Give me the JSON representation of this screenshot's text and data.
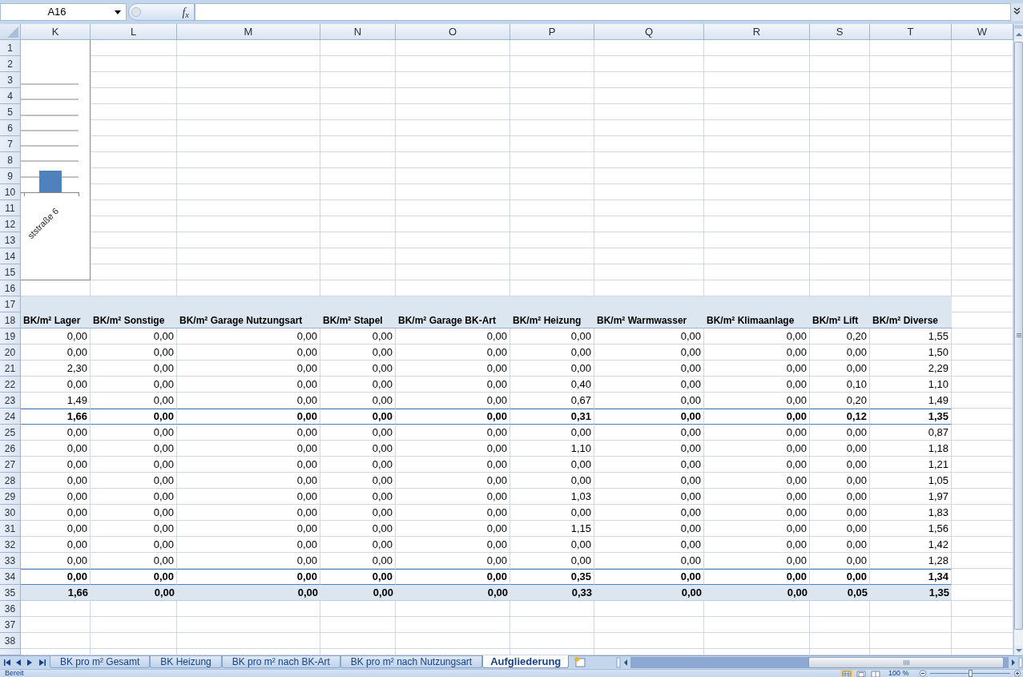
{
  "formula_bar": {
    "name_box": "A16",
    "function_button": "f$_{x}$"
  },
  "chart": {
    "category_label": "ststraße 6"
  },
  "sheet": {
    "columns": [
      "K",
      "L",
      "M",
      "N",
      "O",
      "P",
      "Q",
      "R",
      "S",
      "T",
      "W"
    ],
    "rows": [
      {
        "number": "1",
        "kind": "blank"
      },
      {
        "number": "2",
        "kind": "blank"
      },
      {
        "number": "3",
        "kind": "blank"
      },
      {
        "number": "4",
        "kind": "blank"
      },
      {
        "number": "5",
        "kind": "blank"
      },
      {
        "number": "6",
        "kind": "blank"
      },
      {
        "number": "7",
        "kind": "blank"
      },
      {
        "number": "8",
        "kind": "blank"
      },
      {
        "number": "9",
        "kind": "blank"
      },
      {
        "number": "10",
        "kind": "blank"
      },
      {
        "number": "11",
        "kind": "blank"
      },
      {
        "number": "12",
        "kind": "blank"
      },
      {
        "number": "13",
        "kind": "blank"
      },
      {
        "number": "14",
        "kind": "blank"
      },
      {
        "number": "15",
        "kind": "blank"
      },
      {
        "number": "16",
        "kind": "blank"
      },
      {
        "number": "17",
        "kind": "band"
      },
      {
        "number": "18",
        "kind": "header",
        "cells": [
          "BK/m² Lager",
          "BK/m² Sonstige",
          "BK/m² Garage Nutzungsart",
          "BK/m² Stapel",
          "BK/m² Garage BK-Art",
          "BK/m² Heizung",
          "BK/m² Warmwasser",
          "BK/m² Klimaanlage",
          "BK/m² Lift",
          "BK/m² Diverse"
        ]
      },
      {
        "number": "19",
        "kind": "data",
        "cells": [
          "0,00",
          "0,00",
          "0,00",
          "0,00",
          "0,00",
          "0,00",
          "0,00",
          "0,00",
          "0,20",
          "1,55"
        ]
      },
      {
        "number": "20",
        "kind": "data",
        "cells": [
          "0,00",
          "0,00",
          "0,00",
          "0,00",
          "0,00",
          "0,00",
          "0,00",
          "0,00",
          "0,00",
          "1,50"
        ]
      },
      {
        "number": "21",
        "kind": "data",
        "cells": [
          "2,30",
          "0,00",
          "0,00",
          "0,00",
          "0,00",
          "0,00",
          "0,00",
          "0,00",
          "0,00",
          "2,29"
        ]
      },
      {
        "number": "22",
        "kind": "data",
        "cells": [
          "0,00",
          "0,00",
          "0,00",
          "0,00",
          "0,00",
          "0,40",
          "0,00",
          "0,00",
          "0,10",
          "1,10"
        ]
      },
      {
        "number": "23",
        "kind": "data",
        "cells": [
          "1,49",
          "0,00",
          "0,00",
          "0,00",
          "0,00",
          "0,67",
          "0,00",
          "0,00",
          "0,20",
          "1,49"
        ]
      },
      {
        "number": "24",
        "kind": "subtotal",
        "cells": [
          "1,66",
          "0,00",
          "0,00",
          "0,00",
          "0,00",
          "0,31",
          "0,00",
          "0,00",
          "0,12",
          "1,35"
        ]
      },
      {
        "number": "25",
        "kind": "data",
        "cells": [
          "0,00",
          "0,00",
          "0,00",
          "0,00",
          "0,00",
          "0,00",
          "0,00",
          "0,00",
          "0,00",
          "0,87"
        ]
      },
      {
        "number": "26",
        "kind": "data",
        "cells": [
          "0,00",
          "0,00",
          "0,00",
          "0,00",
          "0,00",
          "1,10",
          "0,00",
          "0,00",
          "0,00",
          "1,18"
        ]
      },
      {
        "number": "27",
        "kind": "data",
        "cells": [
          "0,00",
          "0,00",
          "0,00",
          "0,00",
          "0,00",
          "0,00",
          "0,00",
          "0,00",
          "0,00",
          "1,21"
        ]
      },
      {
        "number": "28",
        "kind": "data",
        "cells": [
          "0,00",
          "0,00",
          "0,00",
          "0,00",
          "0,00",
          "0,00",
          "0,00",
          "0,00",
          "0,00",
          "1,05"
        ]
      },
      {
        "number": "29",
        "kind": "data",
        "cells": [
          "0,00",
          "0,00",
          "0,00",
          "0,00",
          "0,00",
          "1,03",
          "0,00",
          "0,00",
          "0,00",
          "1,97"
        ]
      },
      {
        "number": "30",
        "kind": "data",
        "cells": [
          "0,00",
          "0,00",
          "0,00",
          "0,00",
          "0,00",
          "0,00",
          "0,00",
          "0,00",
          "0,00",
          "1,83"
        ]
      },
      {
        "number": "31",
        "kind": "data",
        "cells": [
          "0,00",
          "0,00",
          "0,00",
          "0,00",
          "0,00",
          "1,15",
          "0,00",
          "0,00",
          "0,00",
          "1,56"
        ]
      },
      {
        "number": "32",
        "kind": "data",
        "cells": [
          "0,00",
          "0,00",
          "0,00",
          "0,00",
          "0,00",
          "0,00",
          "0,00",
          "0,00",
          "0,00",
          "1,42"
        ]
      },
      {
        "number": "33",
        "kind": "data",
        "cells": [
          "0,00",
          "0,00",
          "0,00",
          "0,00",
          "0,00",
          "0,00",
          "0,00",
          "0,00",
          "0,00",
          "1,28"
        ]
      },
      {
        "number": "34",
        "kind": "subtotal",
        "cells": [
          "0,00",
          "0,00",
          "0,00",
          "0,00",
          "0,00",
          "0,35",
          "0,00",
          "0,00",
          "0,00",
          "1,34"
        ]
      },
      {
        "number": "35",
        "kind": "total",
        "cells": [
          "1,66",
          "0,00",
          "0,00",
          "0,00",
          "0,00",
          "0,33",
          "0,00",
          "0,00",
          "0,05",
          "1,35"
        ]
      },
      {
        "number": "36",
        "kind": "blank"
      },
      {
        "number": "37",
        "kind": "blank"
      },
      {
        "number": "38",
        "kind": "blank"
      }
    ]
  },
  "sheet_tabs": [
    {
      "label": "BK pro m² Gesamt",
      "selected": false
    },
    {
      "label": "BK Heizung",
      "selected": false
    },
    {
      "label": "BK pro m² nach BK-Art",
      "selected": false
    },
    {
      "label": "BK pro m² nach Nutzungsart",
      "selected": false
    },
    {
      "label": "Aufgliederung",
      "selected": true
    }
  ],
  "status_bar": {
    "status": "Bereit",
    "view_buttons": [
      {
        "kind": "normal",
        "selected": true
      },
      {
        "kind": "layout",
        "selected": false
      },
      {
        "kind": "pagebreak",
        "selected": false
      }
    ],
    "zoom": "100 %",
    "zoom_slider": {
      "level": 0.5
    }
  }
}
